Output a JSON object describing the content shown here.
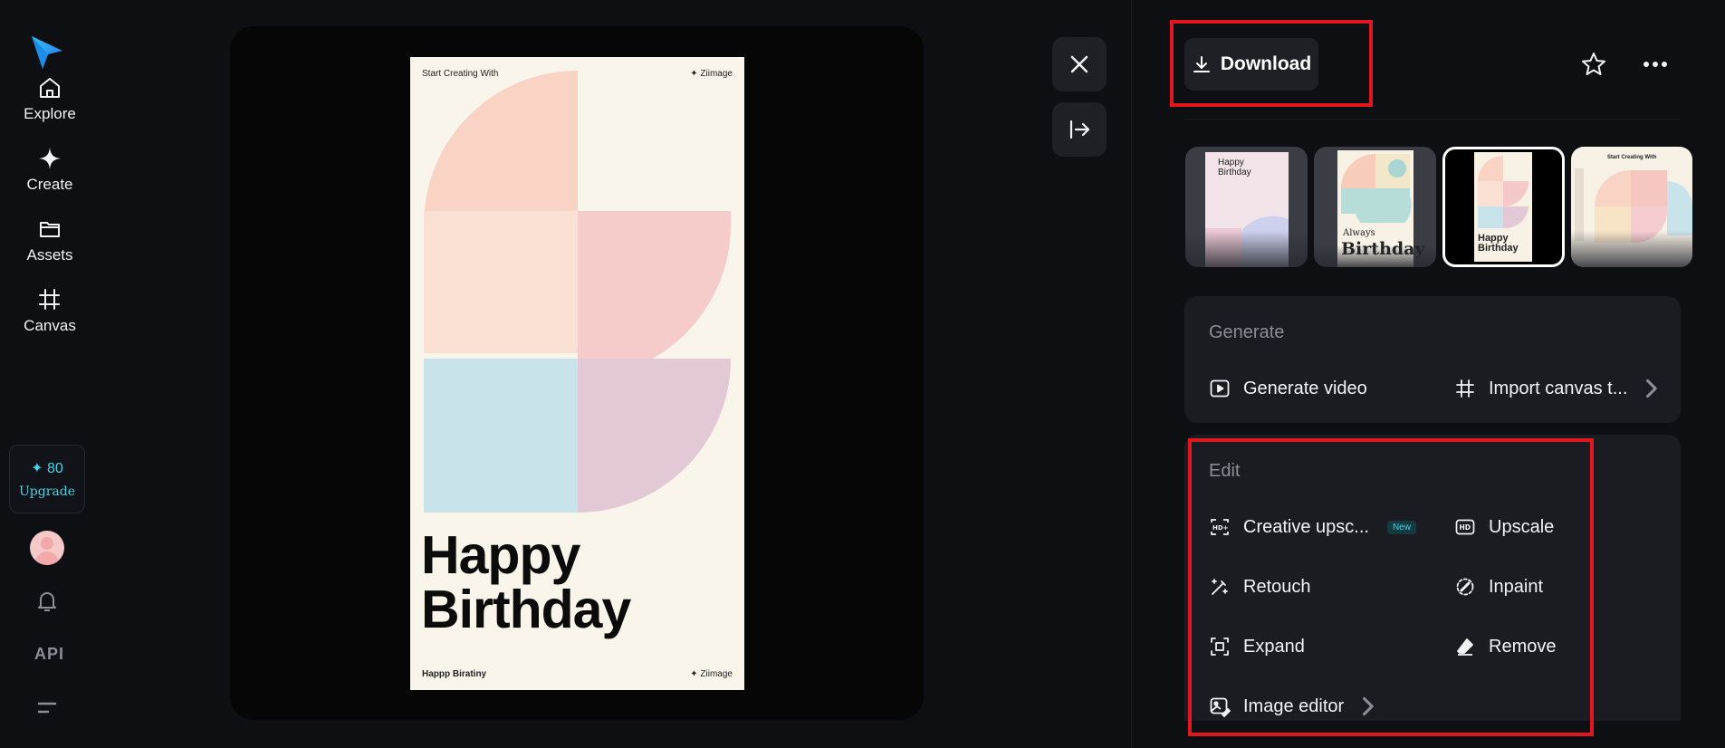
{
  "sidebar": {
    "nav": [
      {
        "label": "Explore",
        "icon": "home-icon"
      },
      {
        "label": "Create",
        "icon": "sparkle-icon"
      },
      {
        "label": "Assets",
        "icon": "folder-icon"
      },
      {
        "label": "Canvas",
        "icon": "crop-icon"
      }
    ],
    "credits": "✦ 80",
    "upgrade_label": "Upgrade",
    "api_label": "API"
  },
  "poster": {
    "top_left": "Start Creating With",
    "top_right": "✦ Ziimage",
    "title_line1": "Happy",
    "title_line2": "Birthday",
    "bottom_left": "Happp Biratiny",
    "bottom_right": "✦ Ziimage",
    "colors": {
      "peach": "#f9d3c3",
      "pink": "#f5c9c9",
      "blue": "#c8e4ea",
      "lilac": "#e3c8d6",
      "bg": "#faf5ea"
    }
  },
  "toolbar": {
    "download_label": "Download"
  },
  "thumbnails": [
    {
      "line1": "Happy",
      "line2": "Birthday"
    },
    {
      "line1": "Always",
      "line2": "Birthday"
    },
    {
      "line1": "Happy",
      "line2": "Birthday"
    },
    {
      "line1": "Start Creating With",
      "line2": ""
    }
  ],
  "generate": {
    "title": "Generate",
    "generate_video": "Generate video",
    "import_canvas": "Import canvas t..."
  },
  "edit": {
    "title": "Edit",
    "creative_upscale": "Creative upsc...",
    "new_badge": "New",
    "upscale": "Upscale",
    "retouch": "Retouch",
    "inpaint": "Inpaint",
    "expand": "Expand",
    "remove": "Remove",
    "image_editor": "Image editor"
  },
  "accent": "#3fd4e8",
  "highlight": "#e0171f"
}
